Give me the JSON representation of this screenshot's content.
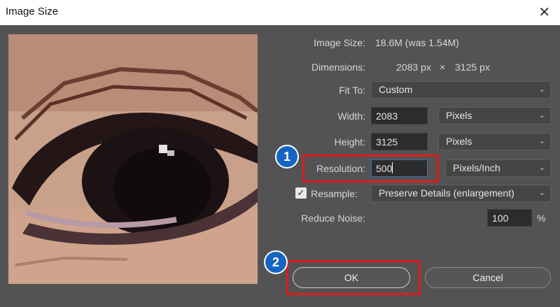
{
  "dialog": {
    "title": "Image Size",
    "close_glyph": "✕"
  },
  "info": {
    "image_size_label": "Image Size:",
    "image_size_value": "18.6M (was 1.54M)",
    "dimensions_label": "Dimensions:",
    "dim_width": "2083 px",
    "dim_times": "×",
    "dim_height": "3125 px"
  },
  "fit_to": {
    "label": "Fit To:",
    "value": "Custom"
  },
  "width": {
    "label": "Width:",
    "value": "2083",
    "unit": "Pixels"
  },
  "height": {
    "label": "Height:",
    "value": "3125",
    "unit": "Pixels"
  },
  "resolution": {
    "label": "Resolution:",
    "value": "500",
    "unit": "Pixels/Inch"
  },
  "resample": {
    "label": "Resample:",
    "checked": true,
    "check_glyph": "✓",
    "method": "Preserve Details (enlargement)"
  },
  "reduce_noise": {
    "label": "Reduce Noise:",
    "value": "100",
    "unit": "%"
  },
  "buttons": {
    "ok": "OK",
    "cancel": "Cancel"
  },
  "annotations": {
    "step1": "1",
    "step2": "2",
    "color": "#e01b1b",
    "badge_color": "#1565c0"
  },
  "icons": {
    "chevron": "chevron-down-icon",
    "close": "close-icon",
    "check": "checkmark-icon"
  }
}
